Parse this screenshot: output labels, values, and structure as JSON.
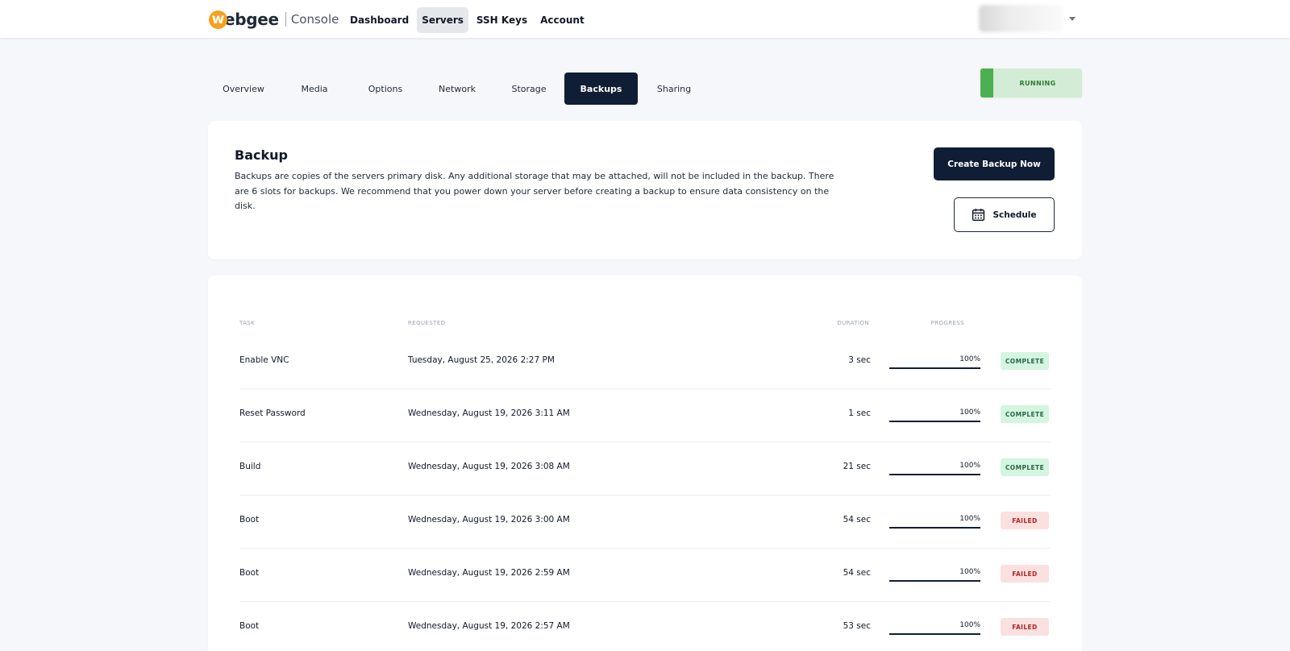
{
  "header": {
    "logo_mark": "w",
    "logo_text": "ebgee",
    "logo_console": "Console",
    "nav": [
      {
        "label": "Dashboard",
        "active": false
      },
      {
        "label": "Servers",
        "active": true
      },
      {
        "label": "SSH Keys",
        "active": false
      },
      {
        "label": "Account",
        "active": false
      }
    ]
  },
  "tabs": [
    {
      "label": "Overview",
      "active": false
    },
    {
      "label": "Media",
      "active": false
    },
    {
      "label": "Options",
      "active": false
    },
    {
      "label": "Network",
      "active": false
    },
    {
      "label": "Storage",
      "active": false
    },
    {
      "label": "Backups",
      "active": true
    },
    {
      "label": "Sharing",
      "active": false
    }
  ],
  "status": {
    "label": "RUNNING",
    "color": "#4caf50"
  },
  "backup": {
    "title": "Backup",
    "description": "Backups are copies of the servers primary disk. Any additional storage that may be attached, will not be included in the backup. There are 6 slots for backups. We recommend that you power down your server before creating a backup to ensure data consistency on the disk.",
    "create_label": "Create Backup Now",
    "schedule_label": "Schedule",
    "schedule_icon": "calendar-icon"
  },
  "table": {
    "headers": {
      "task": "TASK",
      "requested": "REQUESTED",
      "duration": "DURATION",
      "progress": "PROGRESS"
    },
    "rows": [
      {
        "task": "Enable VNC",
        "requested": "Tuesday, August 25, 2026 2:27 PM",
        "duration": "3 sec",
        "progress": 100,
        "progress_label": "100%",
        "status": "COMPLETE",
        "status_kind": "complete"
      },
      {
        "task": "Reset Password",
        "requested": "Wednesday, August 19, 2026 3:11 AM",
        "duration": "1 sec",
        "progress": 100,
        "progress_label": "100%",
        "status": "COMPLETE",
        "status_kind": "complete"
      },
      {
        "task": "Build",
        "requested": "Wednesday, August 19, 2026 3:08 AM",
        "duration": "21 sec",
        "progress": 100,
        "progress_label": "100%",
        "status": "COMPLETE",
        "status_kind": "complete"
      },
      {
        "task": "Boot",
        "requested": "Wednesday, August 19, 2026 3:00 AM",
        "duration": "54 sec",
        "progress": 100,
        "progress_label": "100%",
        "status": "FAILED",
        "status_kind": "failed"
      },
      {
        "task": "Boot",
        "requested": "Wednesday, August 19, 2026 2:59 AM",
        "duration": "54 sec",
        "progress": 100,
        "progress_label": "100%",
        "status": "FAILED",
        "status_kind": "failed"
      },
      {
        "task": "Boot",
        "requested": "Wednesday, August 19, 2026 2:57 AM",
        "duration": "53 sec",
        "progress": 100,
        "progress_label": "100%",
        "status": "FAILED",
        "status_kind": "failed"
      }
    ]
  }
}
